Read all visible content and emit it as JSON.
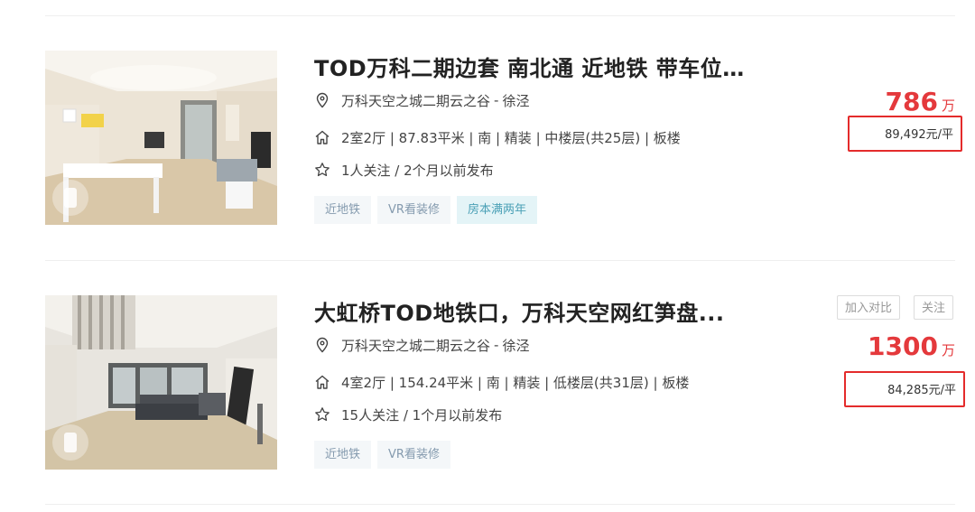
{
  "listings": [
    {
      "title": "TOD万科二期边套 南北通 近地铁 带车位...",
      "community": "万科天空之城二期云之谷",
      "district": "徐泾",
      "details": "2室2厅 | 87.83平米 | 南 | 精装 | 中楼层(共25层) | 板楼",
      "follow": "1人关注 / 2个月以前发布",
      "tags": [
        "近地铁",
        "VR看装修",
        "房本满两年"
      ],
      "total_price": "786",
      "price_unit": "万",
      "unit_price": "89,492元/平"
    },
    {
      "title": "大虹桥TOD地铁口，万科天空网红笋盘...",
      "community": "万科天空之城二期云之谷",
      "district": "徐泾",
      "details": "4室2厅 | 154.24平米 | 南 | 精装 | 低楼层(共31层) | 板楼",
      "follow": "15人关注 / 1个月以前发布",
      "tags": [
        "近地铁",
        "VR看装修"
      ],
      "total_price": "1300",
      "price_unit": "万",
      "unit_price": "84,285元/平",
      "compare_label": "加入对比",
      "follow_label": "关注"
    }
  ],
  "separator": "-",
  "icons": {
    "location": "location-pin-icon",
    "house": "house-icon",
    "star": "star-icon",
    "vr": "vr-icon"
  },
  "colors": {
    "price": "#e4393c",
    "highlight_box": "#e42b2b",
    "tag_text": "#849aae",
    "tag_highlight": "#4aa0b6"
  }
}
